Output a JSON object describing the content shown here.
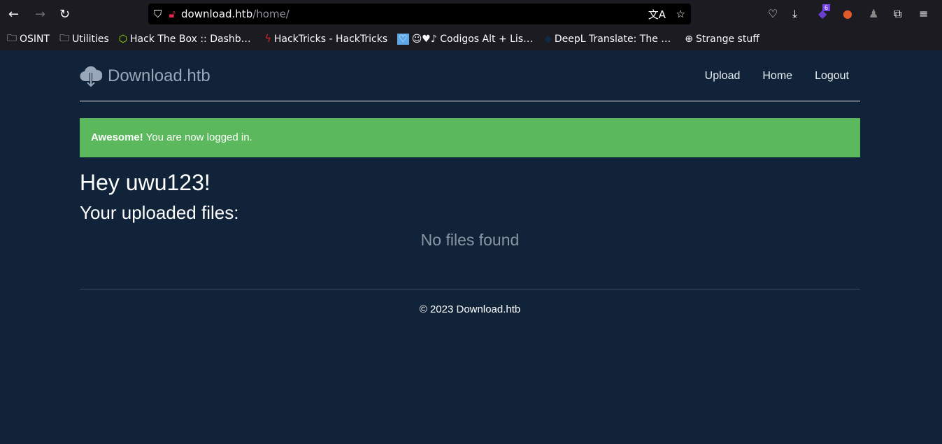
{
  "browser": {
    "url_host": "download.htb",
    "url_path": "/home/",
    "ext_badge": "6",
    "bookmarks": [
      {
        "label": "OSINT",
        "icon": "folder-icon"
      },
      {
        "label": "Utilities",
        "icon": "folder-icon"
      },
      {
        "label": "Hack The Box :: Dashb…",
        "icon": "htb-icon"
      },
      {
        "label": "HackTricks - HackTricks",
        "icon": "hacktricks-icon"
      },
      {
        "label": "☺♥♪ Codigos Alt + Lis…",
        "icon": "heart-icon"
      },
      {
        "label": "DeepL Translate: The …",
        "icon": "deepl-icon"
      },
      {
        "label": "Strange stuff",
        "icon": "globe-icon"
      }
    ]
  },
  "site": {
    "brand": "Download.htb",
    "nav": [
      "Upload",
      "Home",
      "Logout"
    ],
    "alert_strong": "Awesome!",
    "alert_text": " You are now logged in.",
    "greeting": "Hey uwu123!",
    "files_heading": "Your uploaded files:",
    "empty": "No files found",
    "footer": "© 2023 Download.htb",
    "alert_color": "#5cb85c"
  }
}
